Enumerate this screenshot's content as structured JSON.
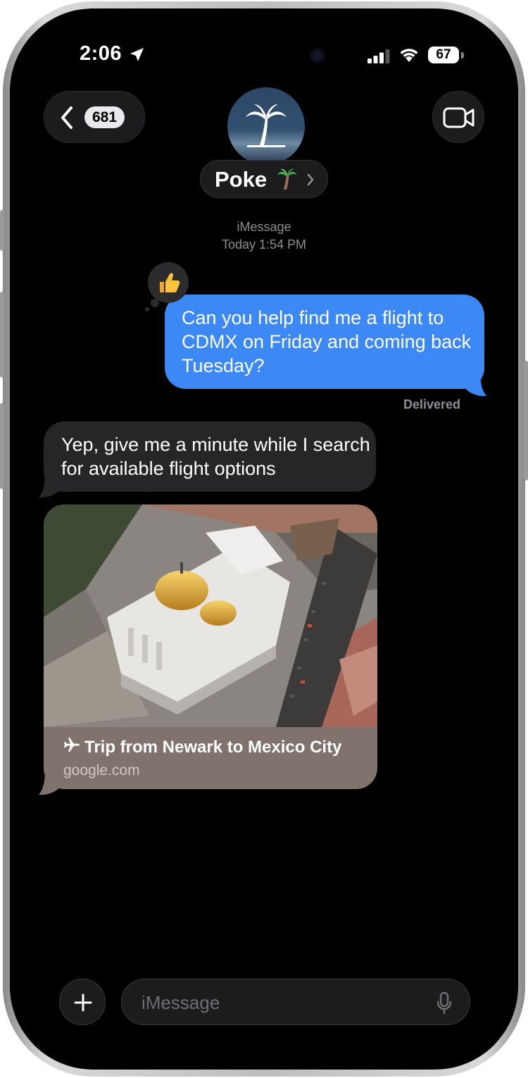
{
  "status_bar": {
    "time": "2:06",
    "battery": "67"
  },
  "nav": {
    "unread_count": "681"
  },
  "contact": {
    "name": "Poke",
    "name_emoji": "🌴"
  },
  "conversation": {
    "service": "iMessage",
    "timestamp": "Today 1:54 PM"
  },
  "messages": [
    {
      "direction": "outgoing",
      "text": "Can you help find me a flight to CDMX on Friday and coming back Tuesday?",
      "reaction": "👍",
      "status": "Delivered"
    },
    {
      "direction": "incoming",
      "text": "Yep, give me a minute while I search for available flight options"
    },
    {
      "direction": "incoming",
      "type": "link-preview",
      "title": "Trip from Newark to Mexico City",
      "title_icon": "airplane-icon",
      "domain": "google.com"
    }
  ],
  "composer": {
    "placeholder": "iMessage"
  },
  "colors": {
    "outgoing_bubble": "#3c88f4",
    "incoming_bubble": "#262628",
    "link_card": "#80726d",
    "background": "#000000"
  }
}
